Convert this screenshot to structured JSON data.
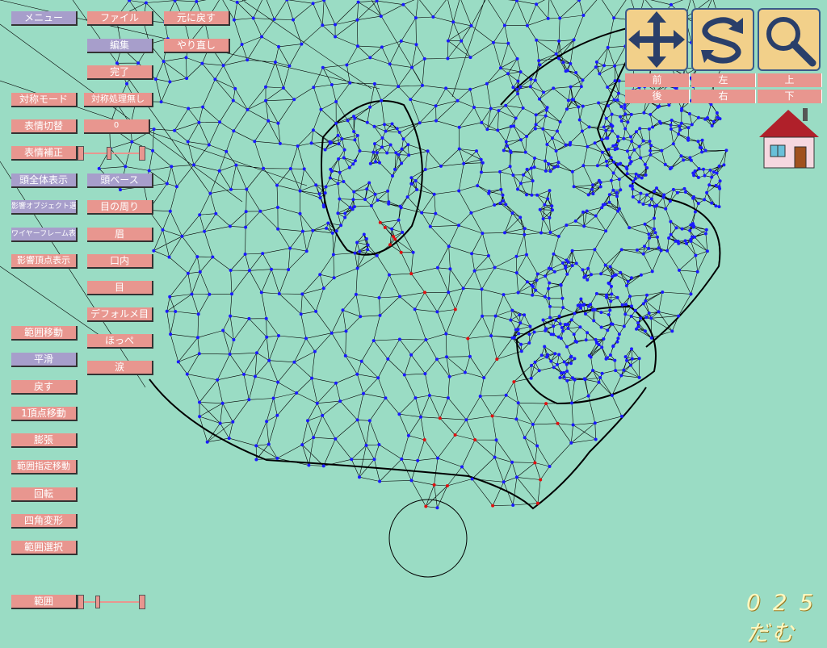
{
  "left_column": {
    "menu": "メニュー",
    "symmetry_mode": "対称モード",
    "expression_switch": "表情切替",
    "expression_correction": "表情補正",
    "show_whole_head": "頭全体表示",
    "affected_object_select": "影響オブジェクト選択",
    "wireframe_display": "ワイヤーフレーム表示",
    "affected_vertex_display": "影響頂点表示",
    "range_move": "範囲移動",
    "smooth": "平滑",
    "revert": "戻す",
    "single_vertex_move": "1頂点移動",
    "inflate": "膨張",
    "range_specified_move": "範囲指定移動",
    "rotate": "回転",
    "quad_deform": "四角変形",
    "range_select": "範囲選択",
    "range": "範囲"
  },
  "mid_column": {
    "file": "ファイル",
    "edit": "編集",
    "done": "完了",
    "no_symmetry": "対称処理無し",
    "expression_value": "0",
    "head_base": "頭ベース",
    "around_eyes": "目の周り",
    "eyebrows": "眉",
    "mouth": "口内",
    "eyes": "目",
    "deformed_eyes": "デフォルメ目",
    "cheeks": "ほっぺ",
    "tears": "涙"
  },
  "undo_column": {
    "undo": "元に戻す",
    "redo": "やり直し"
  },
  "view_controls": {
    "move_icon": "move-arrows-icon",
    "rotate_icon": "rotate-arrows-icon",
    "zoom_icon": "magnifier-icon",
    "front": "前",
    "back": "後",
    "left": "左",
    "right": "右",
    "up": "上",
    "down": "下",
    "home_icon": "house-icon"
  },
  "logo_text": "0 2 5 だむ",
  "colors": {
    "background": "#9adcc4",
    "button_pink": "#e8968f",
    "button_purple": "#a79ecb",
    "vertex_blue": "#1a1aff",
    "vertex_red": "#e01010"
  }
}
